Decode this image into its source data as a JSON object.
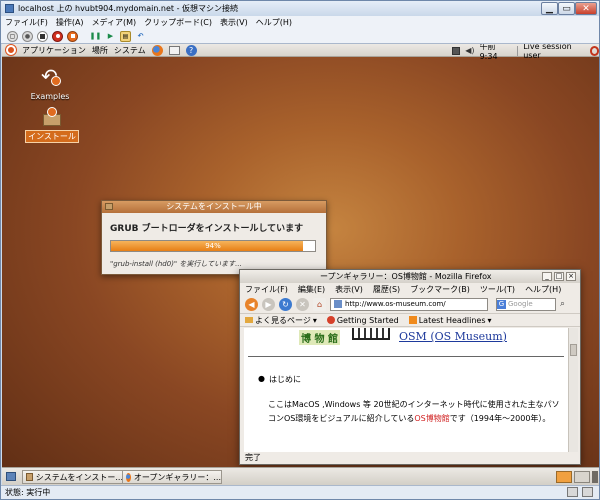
{
  "vm": {
    "title": "localhost 上の hvubt904.mydomain.net - 仮想マシン接続",
    "menu": [
      "ファイル(F)",
      "操作(A)",
      "メディア(M)",
      "クリップボード(C)",
      "表示(V)",
      "ヘルプ(H)"
    ],
    "status": "状態: 実行中"
  },
  "gnome": {
    "menus": [
      "アプリケーション",
      "場所",
      "システム"
    ],
    "clock": "午前 9:34",
    "user": "Live session user"
  },
  "desktop": {
    "icons": [
      {
        "label": "Examples",
        "icon": "examples-icon"
      },
      {
        "label": "インストール",
        "icon": "install-icon"
      }
    ]
  },
  "installer": {
    "title": "システムをインストール中",
    "heading": "GRUB ブートローダをインストールしています",
    "progress": 0.94,
    "progress_label": "94%",
    "detail": "\"grub-install (hd0)\" を実行しています..."
  },
  "firefox": {
    "title": "ープンギャラリー：OS博物館 - Mozilla Firefox",
    "menu": [
      "ファイル(F)",
      "編集(E)",
      "表示(V)",
      "履歴(S)",
      "ブックマーク(B)",
      "ツール(T)",
      "ヘルプ(H)"
    ],
    "url": "http://www.os-museum.com/",
    "search_placeholder": "Google",
    "bookmarks": [
      "よく見るページ",
      "Getting Started",
      "Latest Headlines"
    ],
    "page": {
      "kanji": "博 物 館",
      "site_title": "OSM (OS Museum)",
      "bullet": "はじめに",
      "para_line1": "ここはMacOS ,Windows 等 20世紀のインターネット時代に使用された主なパソ",
      "para_line2_a": "コンOS環境をビジュアルに紹介している",
      "para_line2_link": "OS博物館",
      "para_line2_b": "です（1994年～2000年）。"
    },
    "status": "完了"
  },
  "taskbar": {
    "items": [
      "システムをインストー...",
      "オープンギャラリー：..."
    ]
  }
}
